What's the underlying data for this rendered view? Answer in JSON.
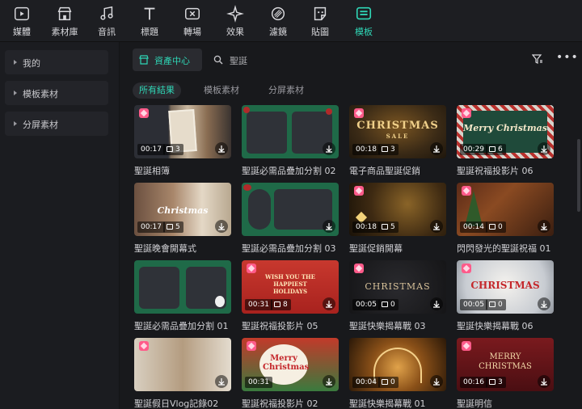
{
  "toolbar": {
    "items": [
      {
        "label": "媒體",
        "icon": "media-icon"
      },
      {
        "label": "素材庫",
        "icon": "store-icon"
      },
      {
        "label": "音訊",
        "icon": "music-note-icon"
      },
      {
        "label": "標題",
        "icon": "text-t-icon"
      },
      {
        "label": "轉場",
        "icon": "transition-icon"
      },
      {
        "label": "效果",
        "icon": "sparkle-effect-icon"
      },
      {
        "label": "濾鏡",
        "icon": "filter-lens-icon"
      },
      {
        "label": "貼圖",
        "icon": "sticker-icon"
      },
      {
        "label": "模板",
        "icon": "template-icon"
      }
    ],
    "active_index": 8,
    "accent": "#2fd6b6"
  },
  "sidebar": {
    "items": [
      {
        "label": "我的"
      },
      {
        "label": "模板素材"
      },
      {
        "label": "分屏素材"
      }
    ]
  },
  "main": {
    "asset_tab": "資產中心",
    "search_placeholder": "聖誕",
    "chips": [
      "所有結果",
      "模板素材",
      "分屏素材"
    ],
    "active_chip": 0
  },
  "cards": [
    {
      "title": "聖誕相簿",
      "duration": "00:17",
      "clips": "3",
      "premium": true
    },
    {
      "title": "聖誕必需品疊加分割 02",
      "duration": "",
      "clips": "",
      "premium": false
    },
    {
      "title": "電子商品聖誕促銷",
      "duration": "00:18",
      "clips": "3",
      "premium": true,
      "art_text": "CHRISTMAS",
      "art_sub": "SALE"
    },
    {
      "title": "聖誕祝福投影片 06",
      "duration": "00:29",
      "clips": "6",
      "premium": true,
      "art_text": "Merry Christmas"
    },
    {
      "title": "聖誕晚會開幕式",
      "duration": "00:17",
      "clips": "5",
      "premium": false,
      "art_text": "Christmas"
    },
    {
      "title": "聖誕必需品疊加分割 03",
      "duration": "",
      "clips": "",
      "premium": false
    },
    {
      "title": "聖誕促銷開幕",
      "duration": "00:18",
      "clips": "5",
      "premium": true
    },
    {
      "title": "閃閃發光的聖誕祝福 01",
      "duration": "00:14",
      "clips": "0",
      "premium": true
    },
    {
      "title": "聖誕必需品疊加分割 01",
      "duration": "",
      "clips": "",
      "premium": false
    },
    {
      "title": "聖誕祝福投影片 05",
      "duration": "00:31",
      "clips": "8",
      "premium": true,
      "art_text": "WISH YOU THE HAPPIEST HOLIDAYS"
    },
    {
      "title": "聖誕快樂揭幕戰 03",
      "duration": "00:05",
      "clips": "0",
      "premium": true,
      "art_text": "CHRISTMAS"
    },
    {
      "title": "聖誕快樂揭幕戰 06",
      "duration": "00:05",
      "clips": "0",
      "premium": true,
      "art_text": "CHRISTMAS"
    },
    {
      "title": "聖誕假日Vlog記錄02",
      "duration": "",
      "clips": "",
      "premium": true
    },
    {
      "title": "聖誕祝福投影片 02",
      "duration": "00:31",
      "clips": "",
      "premium": true,
      "art_text": "Merry Christmas"
    },
    {
      "title": "聖誕快樂揭幕戰 01",
      "duration": "00:04",
      "clips": "0",
      "premium": false
    },
    {
      "title": "聖誕明信",
      "duration": "00:16",
      "clips": "3",
      "premium": true,
      "art_text": "MERRY CHRISTMAS"
    }
  ]
}
